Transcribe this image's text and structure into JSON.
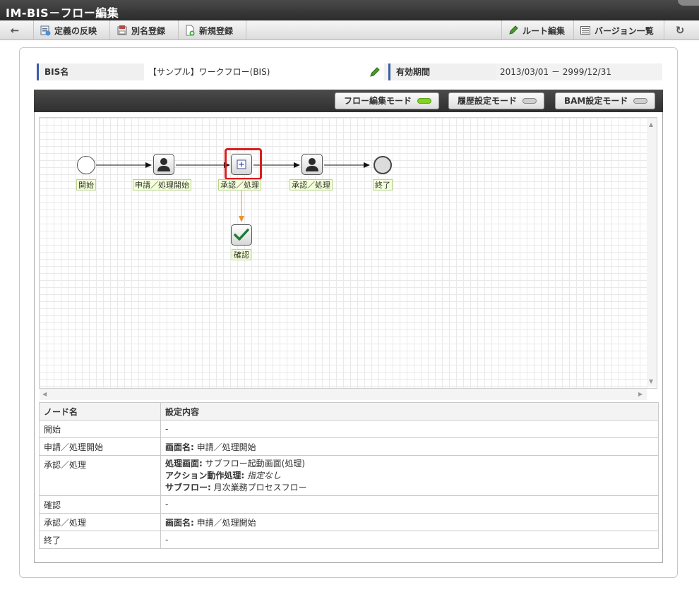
{
  "window": {
    "title": "IM-BIS－フロー編集"
  },
  "toolbar": {
    "apply_label": "定義の反映",
    "alias_label": "別名登録",
    "new_label": "新規登録",
    "route_edit_label": "ルート編集",
    "version_list_label": "バージョン一覧"
  },
  "info": {
    "bis_name_label": "BIS名",
    "bis_name_value": "【サンプル】ワークフロー(BIS)",
    "period_label": "有効期間",
    "period_value": "2013/03/01 － 2999/12/31"
  },
  "modes": {
    "flow_edit": "フロー編集モード",
    "history": "履歴設定モード",
    "bam": "BAM設定モード",
    "active_color": "#7fd321",
    "inactive_color": "#cfcfcf"
  },
  "flow": {
    "nodes": {
      "start": "開始",
      "apply": "申請／処理開始",
      "approve": "承認／処理",
      "approve2": "承認／処理",
      "end": "終了",
      "confirm": "確認"
    },
    "selection_color": "#d81e1e",
    "sub_arrow_color": "#f0932a"
  },
  "table": {
    "headers": {
      "node": "ノード名",
      "settings": "設定内容"
    },
    "rows": [
      {
        "node": "開始",
        "settings": "-"
      },
      {
        "node": "申請／処理開始",
        "s_label": "画面名:",
        "s_value": "申請／処理開始"
      },
      {
        "node": "承認／処理",
        "l1_label": "処理画面:",
        "l1_value": "サブフロー起動画面(処理)",
        "l2_label": "アクション動作処理:",
        "l2_value": "指定なし",
        "l3_label": "サブフロー:",
        "l3_value": "月次業務プロセスフロー"
      },
      {
        "node": "確認",
        "settings": "-"
      },
      {
        "node": "承認／処理",
        "s_label": "画面名:",
        "s_value": "申請／処理開始"
      },
      {
        "node": "終了",
        "settings": "-"
      }
    ]
  }
}
